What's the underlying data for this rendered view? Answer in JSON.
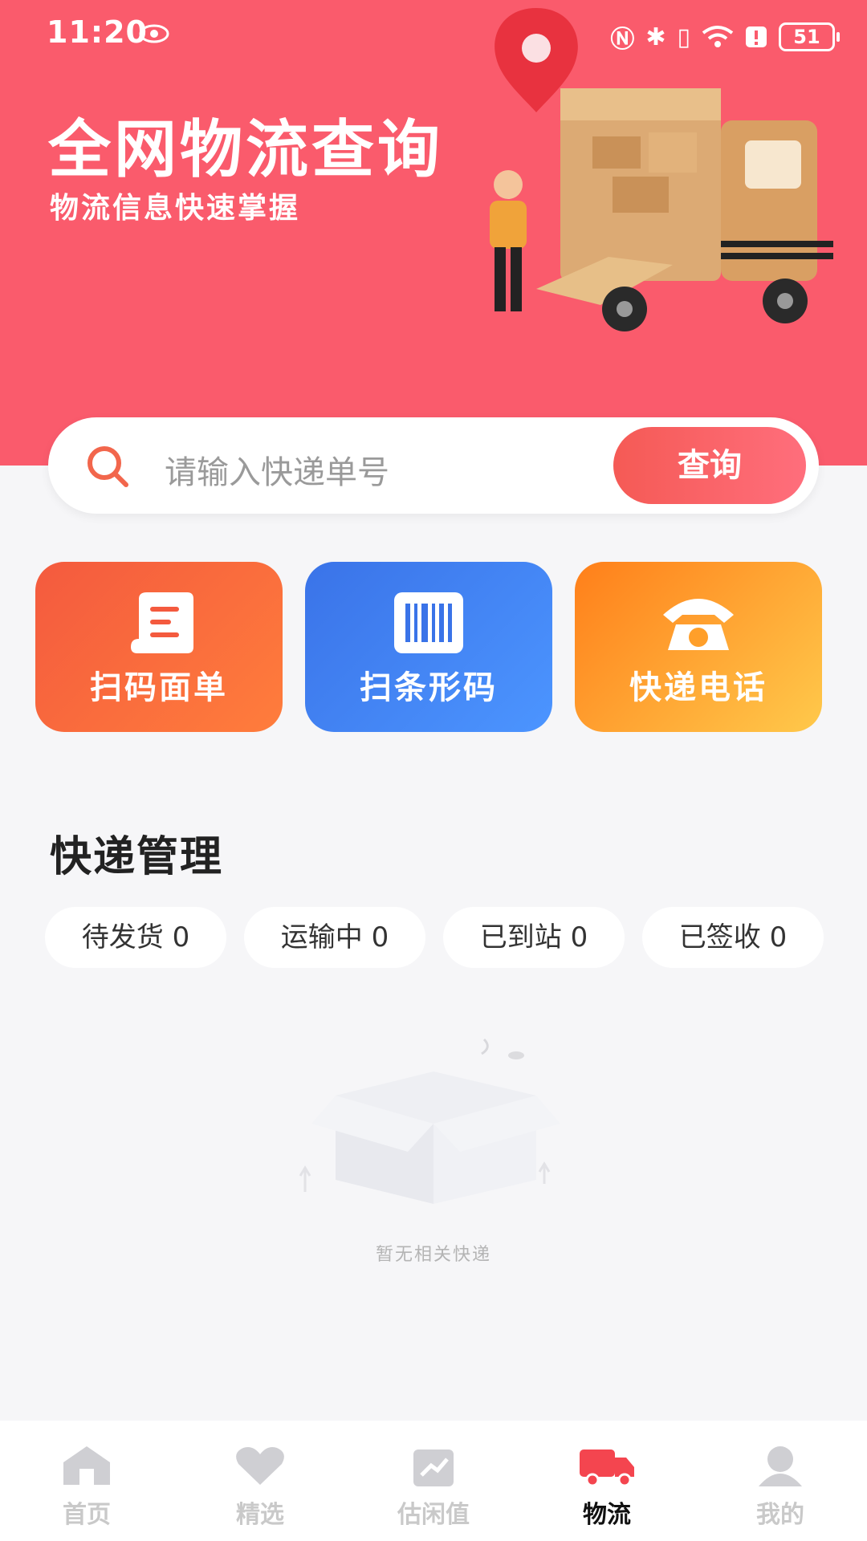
{
  "status_bar": {
    "time": "11:20",
    "battery": "51"
  },
  "hero": {
    "title": "全网物流查询",
    "subtitle": "物流信息快速掌握"
  },
  "search": {
    "placeholder": "请输入快递单号",
    "button_label": "查询"
  },
  "tiles": [
    {
      "label": "扫码面单",
      "icon": "receipt-icon"
    },
    {
      "label": "扫条形码",
      "icon": "barcode-icon"
    },
    {
      "label": "快递电话",
      "icon": "telephone-icon"
    }
  ],
  "management": {
    "title": "快递管理",
    "filters": [
      "待发货 0",
      "运输中 0",
      "已到站 0",
      "已签收 0"
    ]
  },
  "empty_state": {
    "text": "暂无相关快递",
    "icon": "empty-box-icon"
  },
  "tabbar": {
    "items": [
      {
        "label": "首页",
        "icon": "home-icon",
        "active": false
      },
      {
        "label": "精选",
        "icon": "heart-icon",
        "active": false
      },
      {
        "label": "估闲值",
        "icon": "valuation-icon",
        "active": false
      },
      {
        "label": "物流",
        "icon": "truck-icon",
        "active": true
      },
      {
        "label": "我的",
        "icon": "profile-icon",
        "active": false
      }
    ]
  },
  "colors": {
    "hero_bg": "#fa5b6c",
    "tile_red": "#f45a3e",
    "tile_blue": "#3a73e8",
    "tile_orange": "#ff9a2a",
    "active_tab": "#f4454f"
  }
}
